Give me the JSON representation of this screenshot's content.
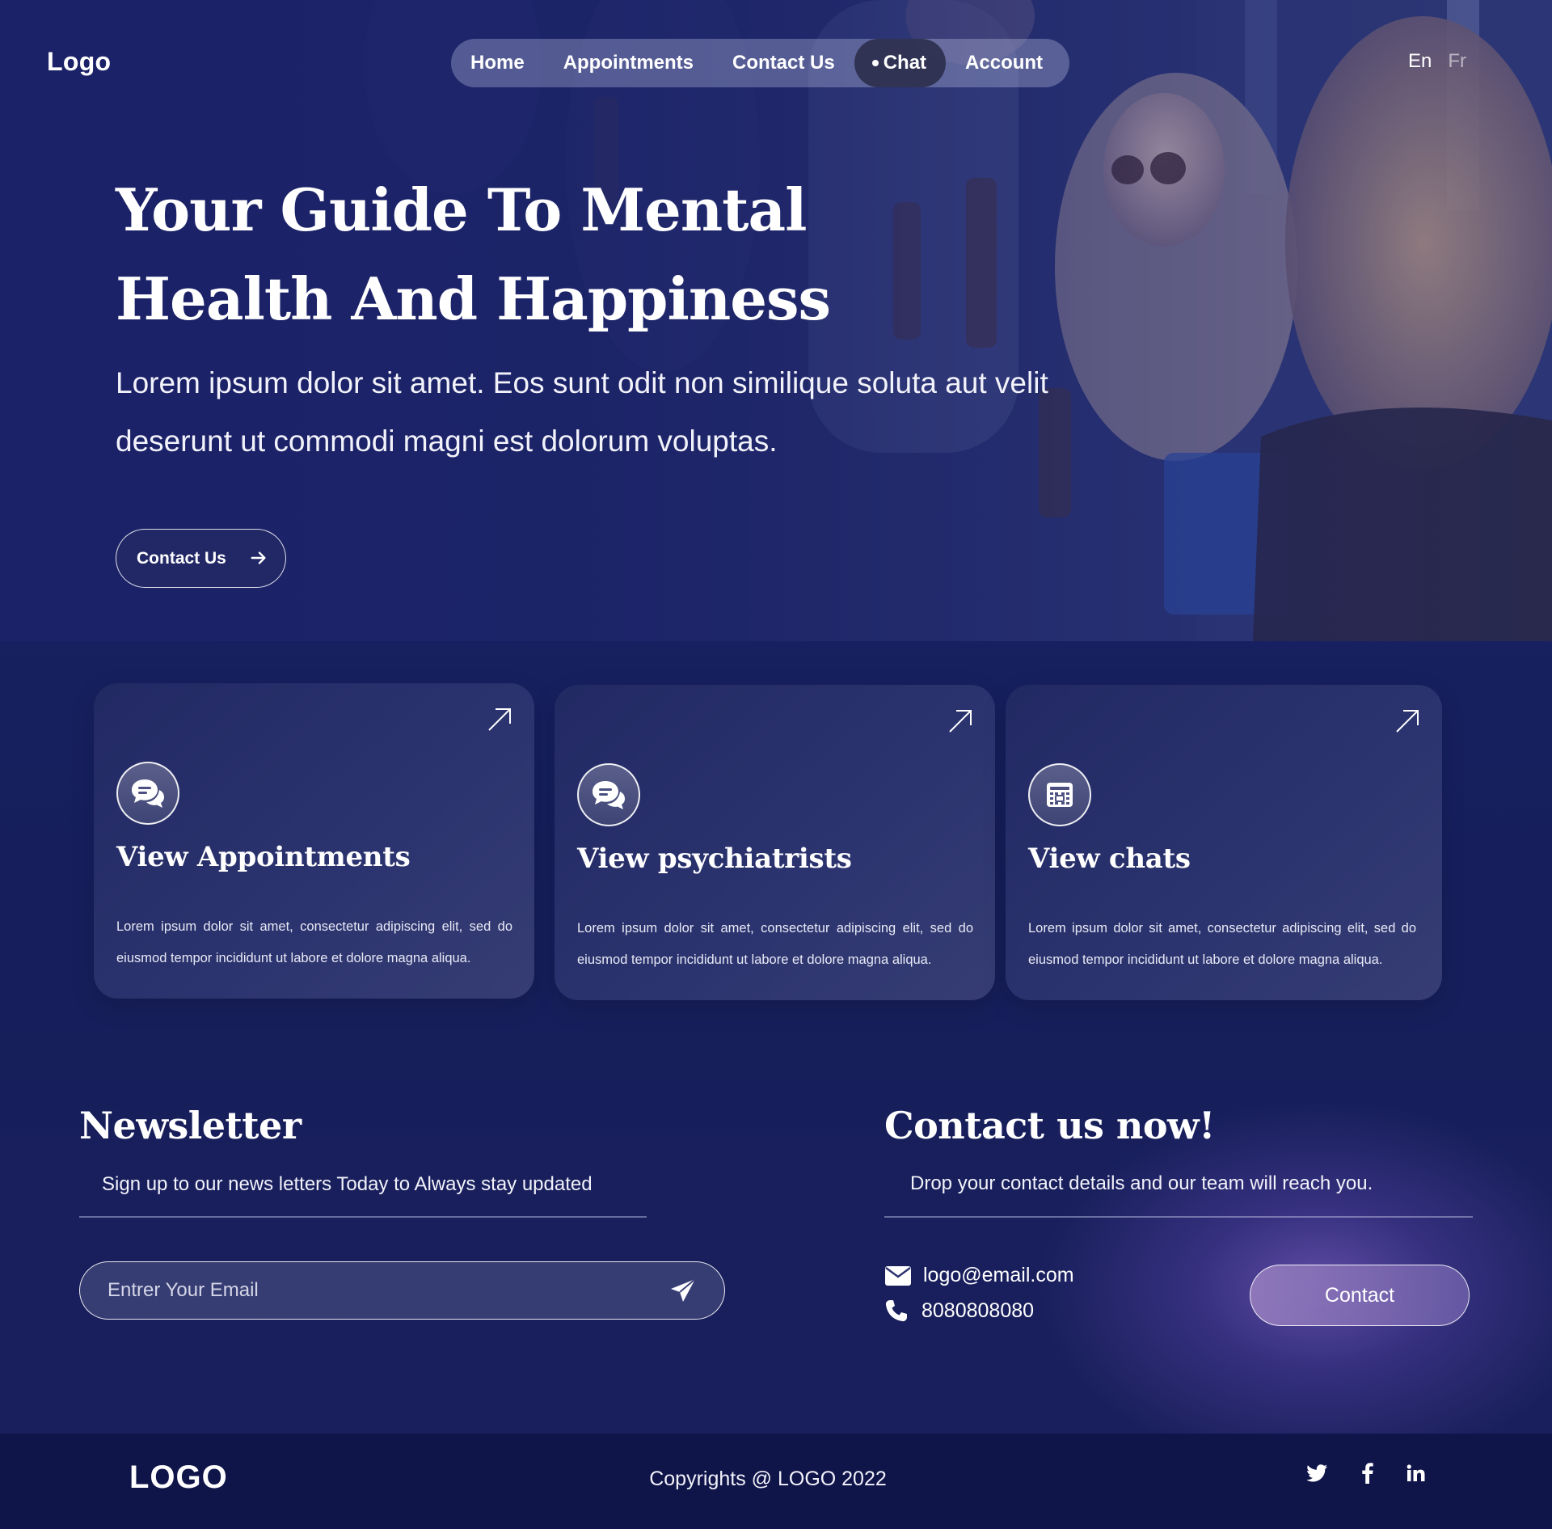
{
  "header": {
    "logo": "Logo",
    "nav": [
      {
        "label": "Home"
      },
      {
        "label": "Appointments"
      },
      {
        "label": "Contact Us"
      },
      {
        "label": "Chat",
        "active": true
      },
      {
        "label": "Account"
      }
    ],
    "languages": {
      "en": "En",
      "fr": "Fr"
    }
  },
  "hero": {
    "title_line1": "Your Guide To Mental",
    "title_line2": "Health And Happiness",
    "subtitle": "Lorem ipsum dolor sit amet. Eos sunt odit non similique soluta aut velit deserunt ut commodi magni est dolorum voluptas.",
    "cta_label": "Contact Us"
  },
  "cards": [
    {
      "title": "View Appointments",
      "icon": "chat-bubbles-icon",
      "text": "Lorem ipsum dolor sit amet, consectetur adipiscing elit, sed do eiusmod tempor incididunt ut labore et dolore magna aliqua."
    },
    {
      "title": "View psychiatrists",
      "icon": "chat-bubbles-icon",
      "text": "Lorem ipsum dolor sit amet, consectetur adipiscing elit, sed do eiusmod tempor incididunt ut labore et dolore magna aliqua."
    },
    {
      "title": "View chats",
      "icon": "calendar-icon",
      "text": "Lorem ipsum dolor sit amet, consectetur adipiscing elit, sed do eiusmod tempor incididunt ut labore et dolore magna aliqua."
    }
  ],
  "newsletter": {
    "title": "Newsletter",
    "subtitle": "Sign up to our news letters Today to Always stay updated",
    "email_placeholder": "Entrer Your Email"
  },
  "contact": {
    "title": "Contact us now!",
    "subtitle": "Drop your contact details and our team will reach you.",
    "email": "logo@email.com",
    "phone": "8080808080",
    "button_label": "Contact"
  },
  "footer": {
    "logo": "LOGO",
    "copyright": "Copyrights @ LOGO 2022",
    "social": [
      "twitter-icon",
      "facebook-icon",
      "linkedin-icon"
    ]
  },
  "colors": {
    "background": "#171f5d",
    "footer": "#0f1449",
    "accent_purple": "#8f79c0"
  }
}
